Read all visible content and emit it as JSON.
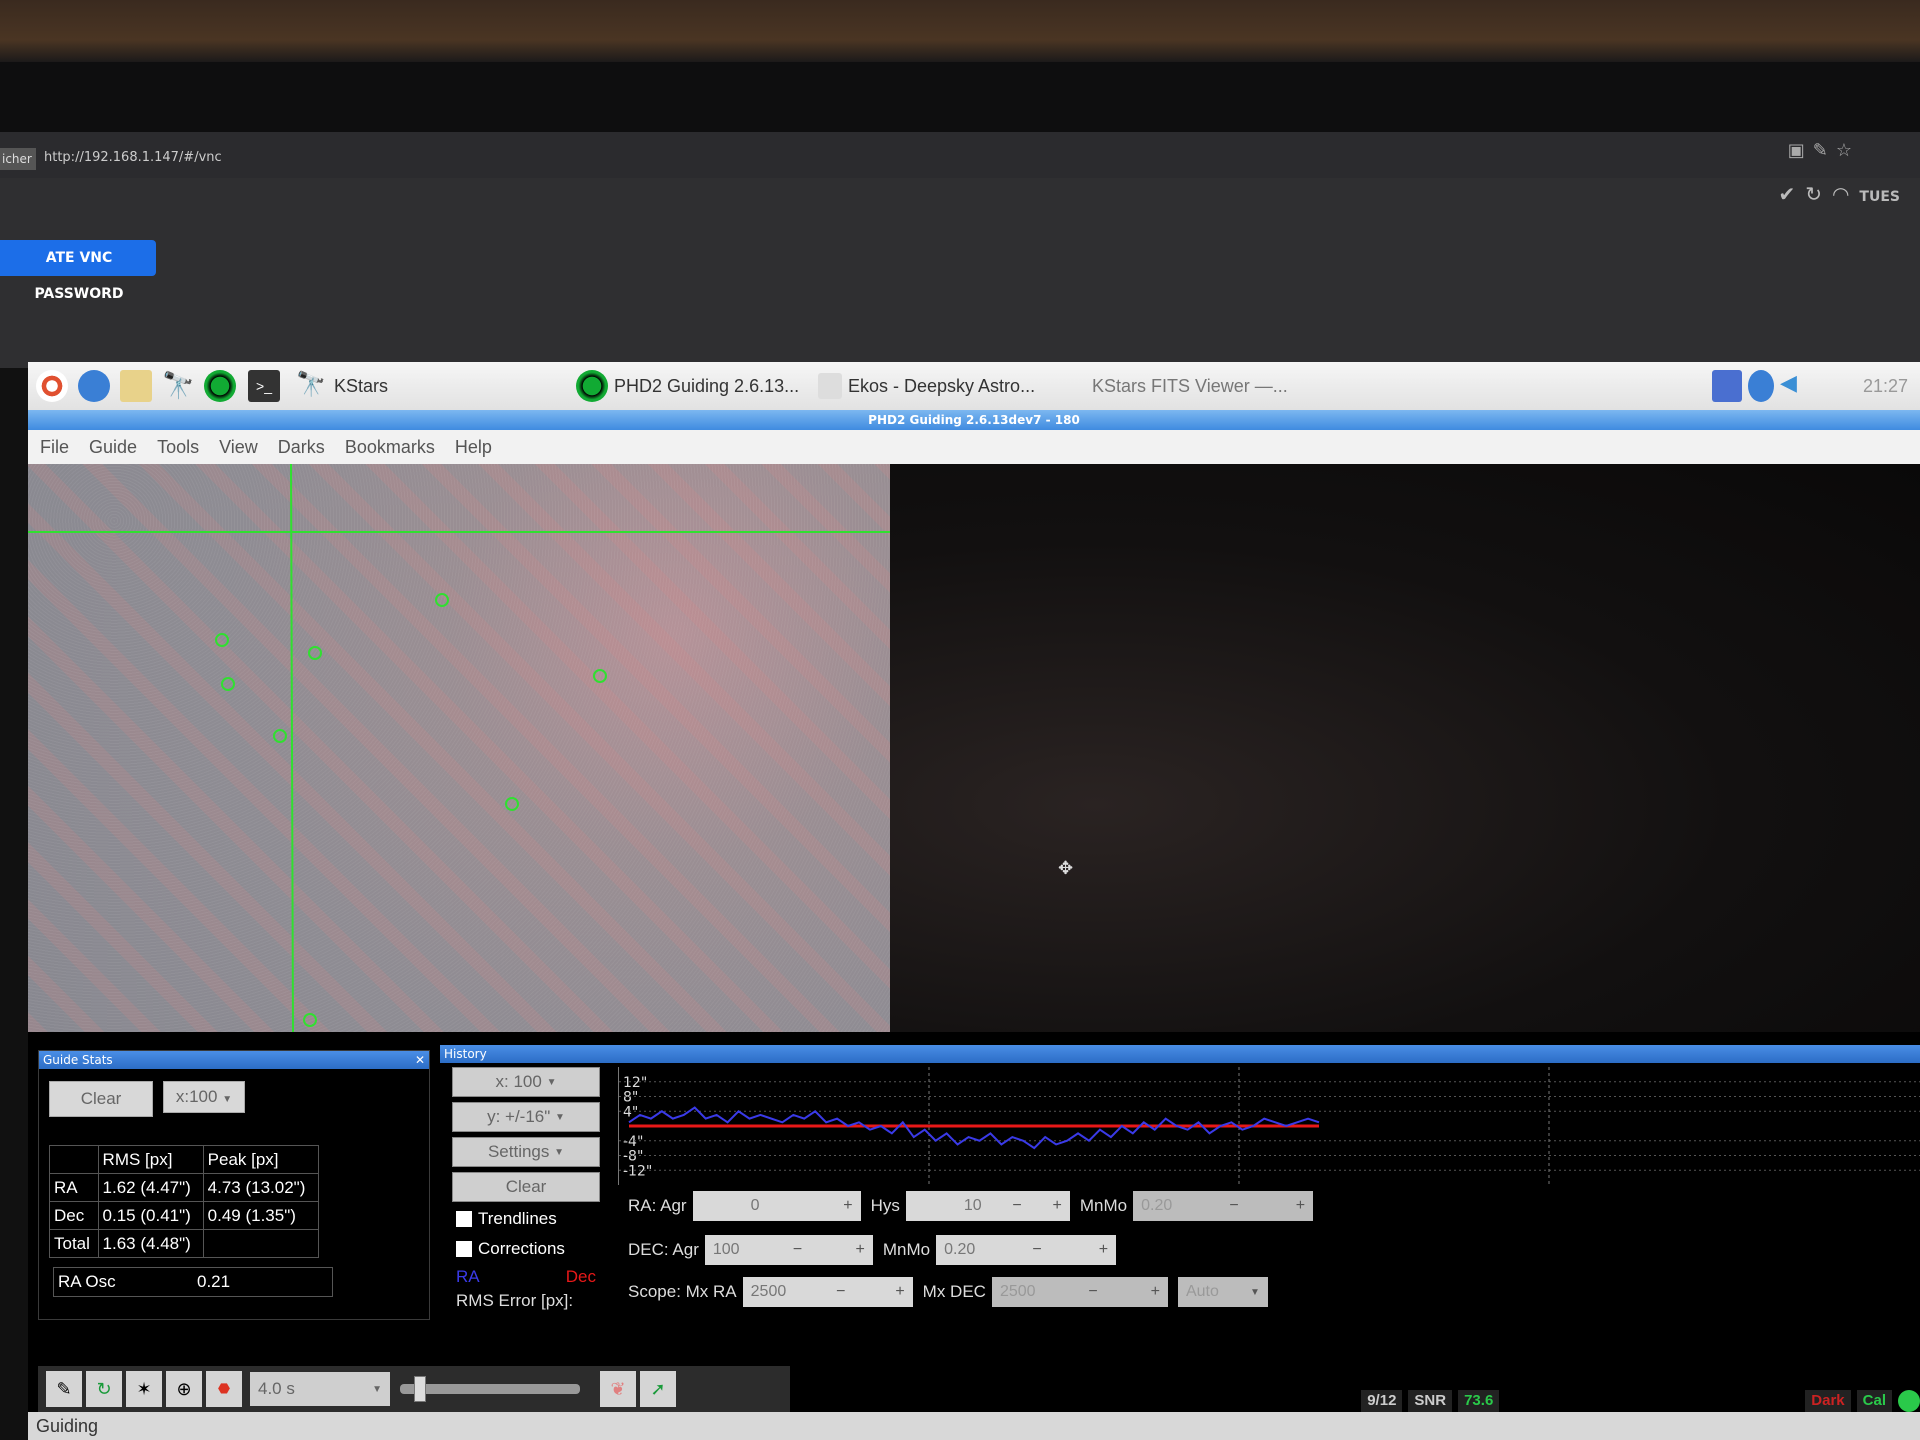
{
  "browser": {
    "tab_fragment": "icher",
    "url": "http://192.168.1.147/#/vnc",
    "status_day": "TUES"
  },
  "vnc": {
    "button_label": "ATE VNC PASSWORD"
  },
  "taskbar": {
    "kstars_label": "KStars",
    "phd2_label": "PHD2 Guiding 2.6.13...",
    "ekos_label": "Ekos - Deepsky Astro...",
    "fits_label": "KStars FITS Viewer —...",
    "clock": "21:27"
  },
  "window": {
    "title": "PHD2 Guiding 2.6.13dev7 - 180"
  },
  "menu": [
    "File",
    "Guide",
    "Tools",
    "View",
    "Darks",
    "Bookmarks",
    "Help"
  ],
  "guide_stats": {
    "title": "Guide Stats",
    "clear": "Clear",
    "scale": "x:100",
    "headers": [
      "",
      "RMS [px]",
      "Peak [px]"
    ],
    "rows": [
      [
        "RA",
        "1.62 (4.47\")",
        "4.73 (13.02\")"
      ],
      [
        "Dec",
        "0.15 (0.41\")",
        "0.49 (1.35\")"
      ],
      [
        "Total",
        "1.63 (4.48\")",
        ""
      ]
    ],
    "ra_osc_label": "RA Osc",
    "ra_osc_value": "0.21"
  },
  "history": {
    "title": "History",
    "x_scale": "x: 100",
    "y_scale": "y: +/-16\"",
    "settings": "Settings",
    "clear": "Clear",
    "trendlines": "Trendlines",
    "corrections": "Corrections",
    "ra_legend": "RA",
    "dec_legend": "Dec",
    "rms_error": "RMS Error [px]:",
    "y_ticks": [
      "12\"",
      "8\"",
      "4\"",
      "-4\"",
      "-8\"",
      "-12\""
    ],
    "ra_agr_label": "RA: Agr",
    "ra_agr": "0",
    "hys_label": "Hys",
    "hys": "10",
    "mnmo_label": "MnMo",
    "ra_mnmo": "0.20",
    "dec_agr_label": "DEC: Agr",
    "dec_agr": "100",
    "dec_mnmo": "0.20",
    "scope_label": "Scope: Mx RA",
    "mx_ra": "2500",
    "mx_dec_label": "Mx DEC",
    "mx_dec": "2500",
    "mode": "Auto",
    "plus": "+",
    "minus": "−"
  },
  "toolbar": {
    "exposure": "4.0 s"
  },
  "statusbar": {
    "text": "Guiding",
    "frames": "9/12",
    "snr_label": "SNR",
    "snr_value": "73.6",
    "dark": "Dark",
    "cal": "Cal"
  },
  "colors": {
    "ra": "#3a3ae8",
    "dec": "#e81818",
    "reticle": "#30e030"
  },
  "chart_data": {
    "type": "line",
    "series": [
      {
        "name": "RA",
        "values": [
          1,
          3,
          2,
          4,
          2,
          3,
          5,
          2,
          3,
          1,
          4,
          2,
          3,
          2,
          1,
          3,
          2,
          4,
          1,
          2,
          0,
          1,
          -1,
          0,
          -2,
          1,
          -3,
          -1,
          -4,
          -2,
          -5,
          -3,
          -4,
          -2,
          -5,
          -3,
          -4,
          -6,
          -3,
          -5,
          -4,
          -2,
          -4,
          -1,
          -3,
          0,
          -2,
          1,
          -1,
          2,
          0,
          -1,
          1,
          -2,
          0,
          1,
          -1,
          0,
          2,
          1,
          0,
          1,
          2,
          1
        ]
      },
      {
        "name": "Dec",
        "values": [
          0,
          0,
          0,
          0,
          0,
          0,
          0,
          0,
          0,
          0,
          0,
          0,
          0,
          0,
          0,
          0,
          0,
          0,
          0,
          0,
          0,
          0,
          0,
          0,
          0,
          0,
          0,
          0,
          0,
          0,
          0,
          0,
          0,
          0,
          0,
          0,
          0,
          0,
          0,
          0,
          0,
          0,
          0,
          0,
          0,
          0,
          0,
          0,
          0,
          0,
          0,
          0,
          0,
          0,
          0,
          0,
          0,
          0,
          0,
          0,
          0,
          0,
          0,
          0
        ]
      }
    ],
    "ylim": [
      -16,
      16
    ]
  }
}
